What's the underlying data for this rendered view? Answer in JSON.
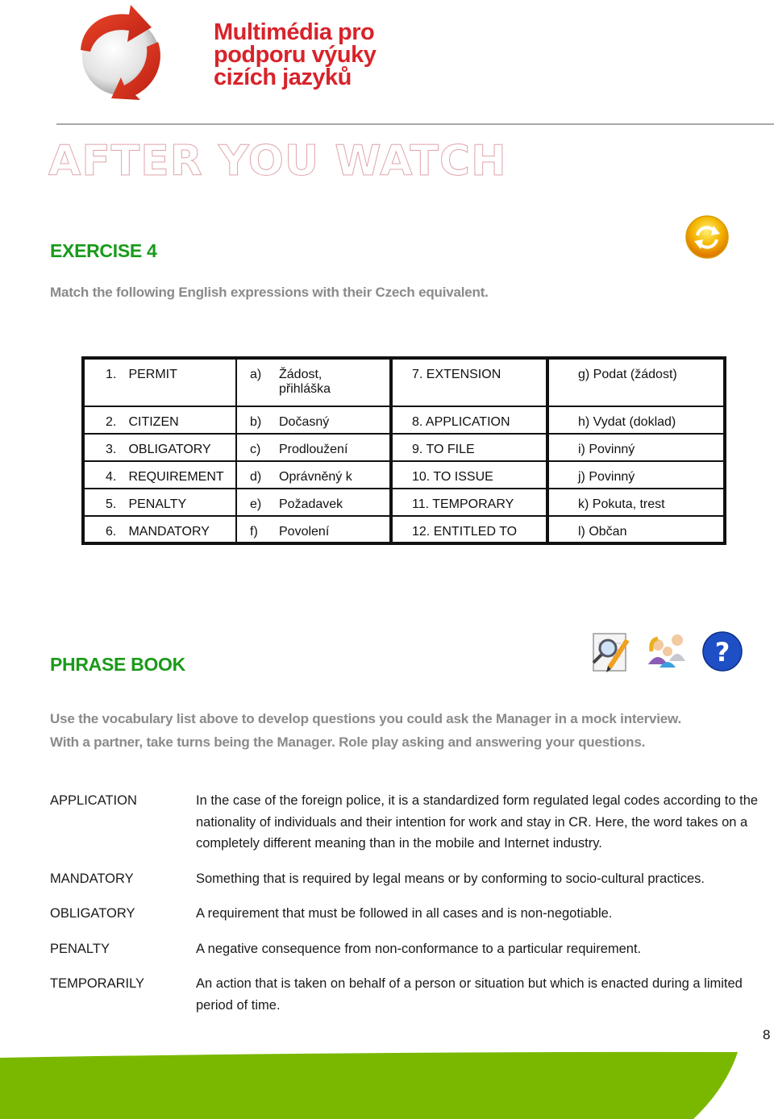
{
  "header": {
    "logo_text": "Multimédia pro\npodporu výuky\ncizích jazyků",
    "logo_icon": "globe-arrows-logo",
    "brand_color": "#d8232a"
  },
  "page_title": "AFTER YOU WATCH",
  "exercise": {
    "heading": "EXERCISE 4",
    "icon": "refresh-icon",
    "instruction": "Match the following English expressions with their Czech equivalent.",
    "heading_color": "#1a9a1a",
    "rows": [
      {
        "en_num": "1.",
        "en": "PERMIT",
        "cz_letter": "a)",
        "cz": "Žádost, přihláška",
        "en2": "7. EXTENSION",
        "cz2": "g)  Podat (žádost)"
      },
      {
        "en_num": "2.",
        "en": "CITIZEN",
        "cz_letter": "b)",
        "cz": "Dočasný",
        "en2": "8. APPLICATION",
        "cz2": "h)  Vydat (doklad)"
      },
      {
        "en_num": "3.",
        "en": "OBLIGATORY",
        "cz_letter": "c)",
        "cz": "Prodloužení",
        "en2": "9.  TO FILE",
        "cz2": "i) Povinný"
      },
      {
        "en_num": "4.",
        "en": "REQUIREMENT",
        "cz_letter": "d)",
        "cz": "Oprávněný k",
        "en2": "10.  TO ISSUE",
        "cz2": "j) Povinný"
      },
      {
        "en_num": "5.",
        "en": "PENALTY",
        "cz_letter": "e)",
        "cz": "Požadavek",
        "en2": "11. TEMPORARY",
        "cz2": "k) Pokuta, trest"
      },
      {
        "en_num": "6.",
        "en": "MANDATORY",
        "cz_letter": "f)",
        "cz": "Povolení",
        "en2": "12.  ENTITLED TO",
        "cz2": "l) Občan"
      }
    ]
  },
  "phrase_book": {
    "heading": "PHRASE BOOK",
    "icons": [
      "document-search-edit-icon",
      "people-group-icon",
      "help-question-icon"
    ],
    "instruction_lines": [
      "Use the vocabulary list above to develop questions you could ask the Manager in a mock interview.",
      "With a partner, take turns being the Manager. Role play asking and answering your questions."
    ],
    "glossary": [
      {
        "term": "APPLICATION",
        "definition": "In the case of the foreign police, it is a standardized form regulated legal codes according to the nationality of individuals and their intention for work and stay in CR. Here, the word takes on a completely different meaning than in the mobile and Internet industry."
      },
      {
        "term": "MANDATORY",
        "definition": "Something that is required by legal means or by conforming to socio-cultural practices."
      },
      {
        "term": "OBLIGATORY",
        "definition": "A requirement that must be followed in all cases and is non-negotiable."
      },
      {
        "term": "PENALTY",
        "definition": "A negative consequence from non-conformance to a particular requirement."
      },
      {
        "term": "TEMPORARILY",
        "definition": "An action that is taken on behalf of a person or situation but which is enacted during a limited period of time."
      }
    ]
  },
  "footer": {
    "page_number": "8",
    "swoosh_color": "#7ab800"
  }
}
